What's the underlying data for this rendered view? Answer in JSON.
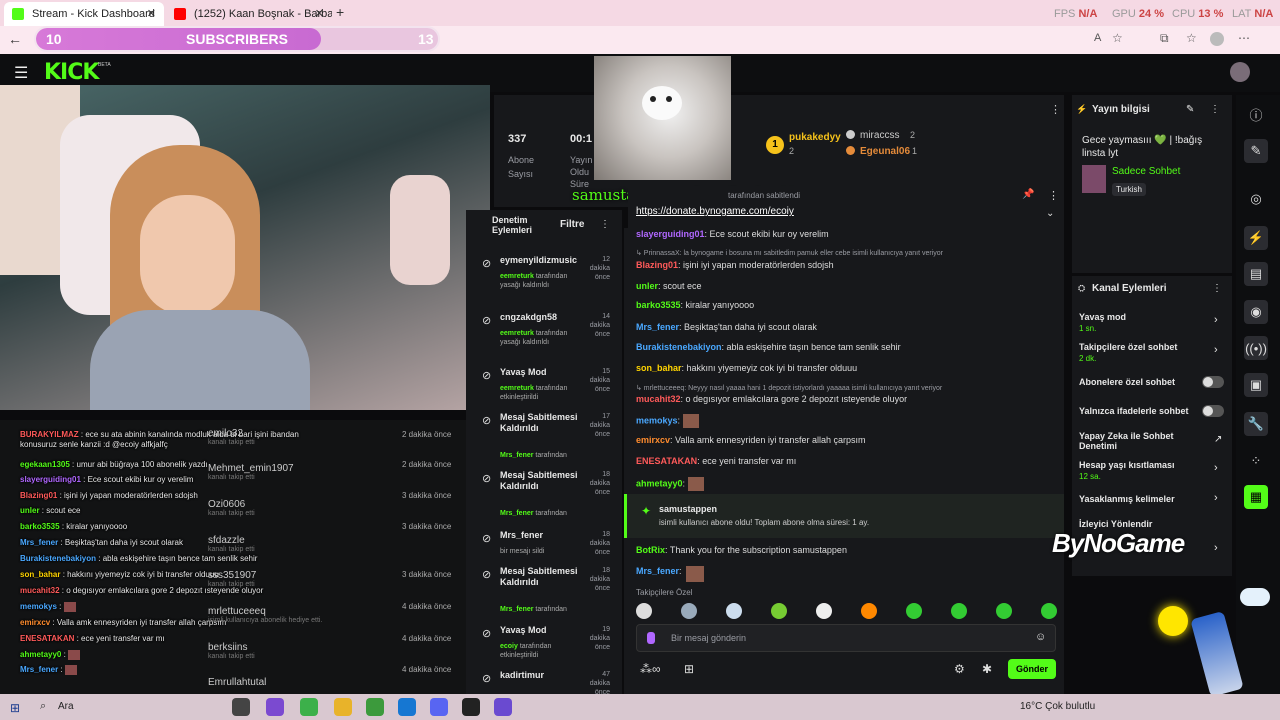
{
  "browser": {
    "tab1": "Stream - Kick Dashboard",
    "tab2": "(1252) Kaan Boşnak - Barbar",
    "perf": {
      "fps_label": "FPS",
      "fps": "N/A",
      "gpu_label": "GPU",
      "gpu": "24 %",
      "cpu_label": "CPU",
      "cpu": "13 %",
      "lat_label": "LAT",
      "lat": "N/A"
    }
  },
  "goal": {
    "start": "10",
    "label": "SUBSCRIBERS",
    "end": "13",
    "progress": 0.71
  },
  "kick": {
    "logo": "KICK",
    "beta": "BETA"
  },
  "stats": {
    "subs_value": "337",
    "subs_label1": "Abone",
    "subs_label2": "Sayısı",
    "time_value": "00:1",
    "time_l1": "Yayın",
    "time_l2": "Oldu",
    "time_l3": "Süre"
  },
  "overlay": {
    "subscribed": "samustappen subscribed x 1!"
  },
  "leaders": {
    "first": "pukakedyy",
    "first_n": "2",
    "second": "miraccss",
    "second_n": "2",
    "third": "Egeunal06",
    "third_n": "1"
  },
  "pinned": {
    "by": "tarafından sabitlendi",
    "link": "https://donate.bynogame.com/ecoiy"
  },
  "mod": {
    "header": "Denetim Eylemleri",
    "filter": "Filtre",
    "items": [
      {
        "name": "eymenyildizmusic",
        "ts": "12 dakika önce",
        "who": "eemreturk",
        "action": "tarafından yasağı kaldırıldı"
      },
      {
        "name": "cngzakdgn58",
        "ts": "14 dakika önce",
        "who": "eemreturk",
        "action": "tarafından yasağı kaldırıldı"
      },
      {
        "name": "Yavaş Mod",
        "ts": "15 dakika önce",
        "who": "eemreturk",
        "action": "tarafından etkinleştirildi"
      },
      {
        "name": "Mesaj Sabitlemesi Kaldırıldı",
        "ts": "17 dakika önce",
        "who": "Mrs_fener",
        "action": "tarafından"
      },
      {
        "name": "Mesaj Sabitlemesi Kaldırıldı",
        "ts": "18 dakika önce",
        "who": "Mrs_fener",
        "action": "tarafından"
      },
      {
        "name": "Mrs_fener",
        "ts": "18 dakika önce",
        "who": "",
        "action": "bir mesajı sildi"
      },
      {
        "name": "Mesaj Sabitlemesi Kaldırıldı",
        "ts": "18 dakika önce",
        "who": "Mrs_fener",
        "action": "tarafından"
      },
      {
        "name": "Yavaş Mod",
        "ts": "19 dakika önce",
        "who": "ecoiy",
        "action": "tarafından etkinleştirildi"
      },
      {
        "name": "kadirtimur",
        "ts": "47 dakika önce",
        "who": "",
        "action": ""
      }
    ]
  },
  "chat": {
    "lines": [
      {
        "user": "slayerguiding01",
        "msg": "Ece scout ekibi kur oy verelim",
        "cls": "u-purple"
      },
      {
        "user": "",
        "msg": "PrinnassaX: la bynogame i bosuna mı sabitledim pamuk eller cebe isimli kullanıcıya yanıt veriyor",
        "cls": "muted"
      },
      {
        "user": "Blazing01",
        "msg": "işini iyi yapan moderatörlerden sdojsh",
        "cls": "u-red"
      },
      {
        "user": "unler",
        "msg": "scout ece",
        "cls": "u-green"
      },
      {
        "user": "barko3535",
        "msg": "kiralar yanıyoooo",
        "cls": "u-green"
      },
      {
        "user": "Mrs_fener",
        "msg": "Beşiktaş'tan daha iyi scout olarak",
        "cls": "u-blue"
      },
      {
        "user": "Burakistenebakiyon",
        "msg": "abla eskişehire taşın bence tam senlik sehir",
        "cls": "u-blue"
      },
      {
        "user": "son_bahar",
        "msg": "hakkını yiyemeyiz cok iyi bi transfer olduuu",
        "cls": "u-yellow"
      },
      {
        "user": "",
        "msg": "mrlettuceeeq: Neyyy nasıl yaaaa hani 1 depozit istiyorlardı yaaaaa isimli kullanıcıya yanıt veriyor",
        "cls": "muted"
      },
      {
        "user": "mucahit32",
        "msg": "o degısıyor emlakcılara gore 2 depozıt ısteyende oluyor",
        "cls": "u-red"
      },
      {
        "user": "memokys",
        "msg": "",
        "cls": "u-blue"
      },
      {
        "user": "emirxcv",
        "msg": "Valla amk ennesyriden iyi transfer allah çarpsım",
        "cls": "u-orange"
      },
      {
        "user": "ENESATAKAN",
        "msg": "ece yeni transfer var mı",
        "cls": "u-red"
      },
      {
        "user": "ahmetayy0",
        "msg": "",
        "cls": "u-green"
      }
    ],
    "sub_user": "samustappen",
    "sub_msg": "isimli kullanıcı abone oldu! Toplam abone olma süresi: 1 ay.",
    "botrix": "BotRix",
    "botrix_msg": "Thank you for the subscription samustappen",
    "last_user": "Mrs_fener",
    "emote_label": "Takipçilere Özel",
    "input_placeholder": "Bir mesaj gönderin",
    "send": "Gönder"
  },
  "streaminfo": {
    "header": "Yayın bilgisi",
    "title": "Gece yaymasııı 💚 | !bağış linsta lyt",
    "category": "Sadece Sohbet",
    "lang": "Turkish"
  },
  "actions": {
    "header": "Kanal Eylemleri",
    "slow": "Yavaş mod",
    "slow_v": "1 sn.",
    "follower": "Takipçilere özel sohbet",
    "follower_v": "2 dk.",
    "subonly": "Abonelere özel sohbet",
    "emoteonly": "Yalnızca ifadelerle sohbet",
    "ai": "Yapay Zeka ile Sohbet Denetimi",
    "age": "Hesap yaşı kısıtlaması",
    "age_v": "12 sa.",
    "banned": "Yasaklanmış kelimeler",
    "redirect": "İzleyici Yönlendir"
  },
  "brand": "ByNoGame",
  "overlay_chat": [
    {
      "user": "BURAKYILMAZ",
      "msg": "ece su ata abinin kanalında modluk alda bi bari işini ibandan konusuruz senle kanzii :d @ecoiy alfkjalfç",
      "cls": "u-red",
      "ts": "2 dakika önce"
    },
    {
      "user": "egekaan1305",
      "msg": "umur abi büğraya 100 abonelik yazdı",
      "cls": "u-green",
      "ts": "2 dakika önce"
    },
    {
      "user": "slayerguiding01",
      "msg": "Ece scout ekibi kur oy verelim",
      "cls": "u-purple",
      "ts": ""
    },
    {
      "user": "Blazing01",
      "msg": "işini iyi yapan moderatörlerden sdojsh",
      "cls": "u-red",
      "ts": "3 dakika önce"
    },
    {
      "user": "unler",
      "msg": "scout ece",
      "cls": "u-green",
      "ts": ""
    },
    {
      "user": "barko3535",
      "msg": "kiralar yanıyoooo",
      "cls": "u-green",
      "ts": "3 dakika önce"
    },
    {
      "user": "Mrs_fener",
      "msg": "Beşiktaş'tan daha iyi scout olarak",
      "cls": "u-blue",
      "ts": ""
    },
    {
      "user": "Burakistenebakiyon",
      "msg": "abla eskişehire taşın bence tam senlik sehir",
      "cls": "u-blue",
      "ts": ""
    },
    {
      "user": "son_bahar",
      "msg": "hakkını yiyemeyiz cok iyi bi transfer olduuu",
      "cls": "u-yellow",
      "ts": "3 dakika önce"
    },
    {
      "user": "mucahit32",
      "msg": "o degısıyor emlakcılara gore 2 depozıt ısteyende oluyor",
      "cls": "u-red",
      "ts": ""
    },
    {
      "user": "memokys",
      "msg": "",
      "cls": "u-blue",
      "ts": "4 dakika önce"
    },
    {
      "user": "emirxcv",
      "msg": "Valla amk ennesyriden iyi transfer allah çarpsım",
      "cls": "u-orange",
      "ts": ""
    },
    {
      "user": "ENESATAKAN",
      "msg": "ece yeni transfer var mı",
      "cls": "u-red",
      "ts": "4 dakika önce"
    },
    {
      "user": "ahmetayy0",
      "msg": "",
      "cls": "u-green",
      "ts": ""
    },
    {
      "user": "Mrs_fener",
      "msg": "",
      "cls": "u-blue",
      "ts": "4 dakika önce"
    }
  ],
  "followers": [
    {
      "name": "emilo32",
      "sub": "kanalı takip etti"
    },
    {
      "name": "Mehmet_emin1907",
      "sub": "kanalı takip etti"
    },
    {
      "name": "Ozi0606",
      "sub": "kanalı takip etti"
    },
    {
      "name": "sfdazzle",
      "sub": "kanalı takip etti"
    },
    {
      "name": "sss351907",
      "sub": "kanalı takip etti"
    },
    {
      "name": "mrlettuceeeq",
      "sub": "isimli kullanıcıya abonelik hediye etti."
    },
    {
      "name": "berksiins",
      "sub": "kanalı takip etti"
    },
    {
      "name": "Emrullahtutal",
      "sub": ""
    }
  ],
  "taskbar": {
    "search": "Ara",
    "weather": "16°C  Çok bulutlu"
  }
}
